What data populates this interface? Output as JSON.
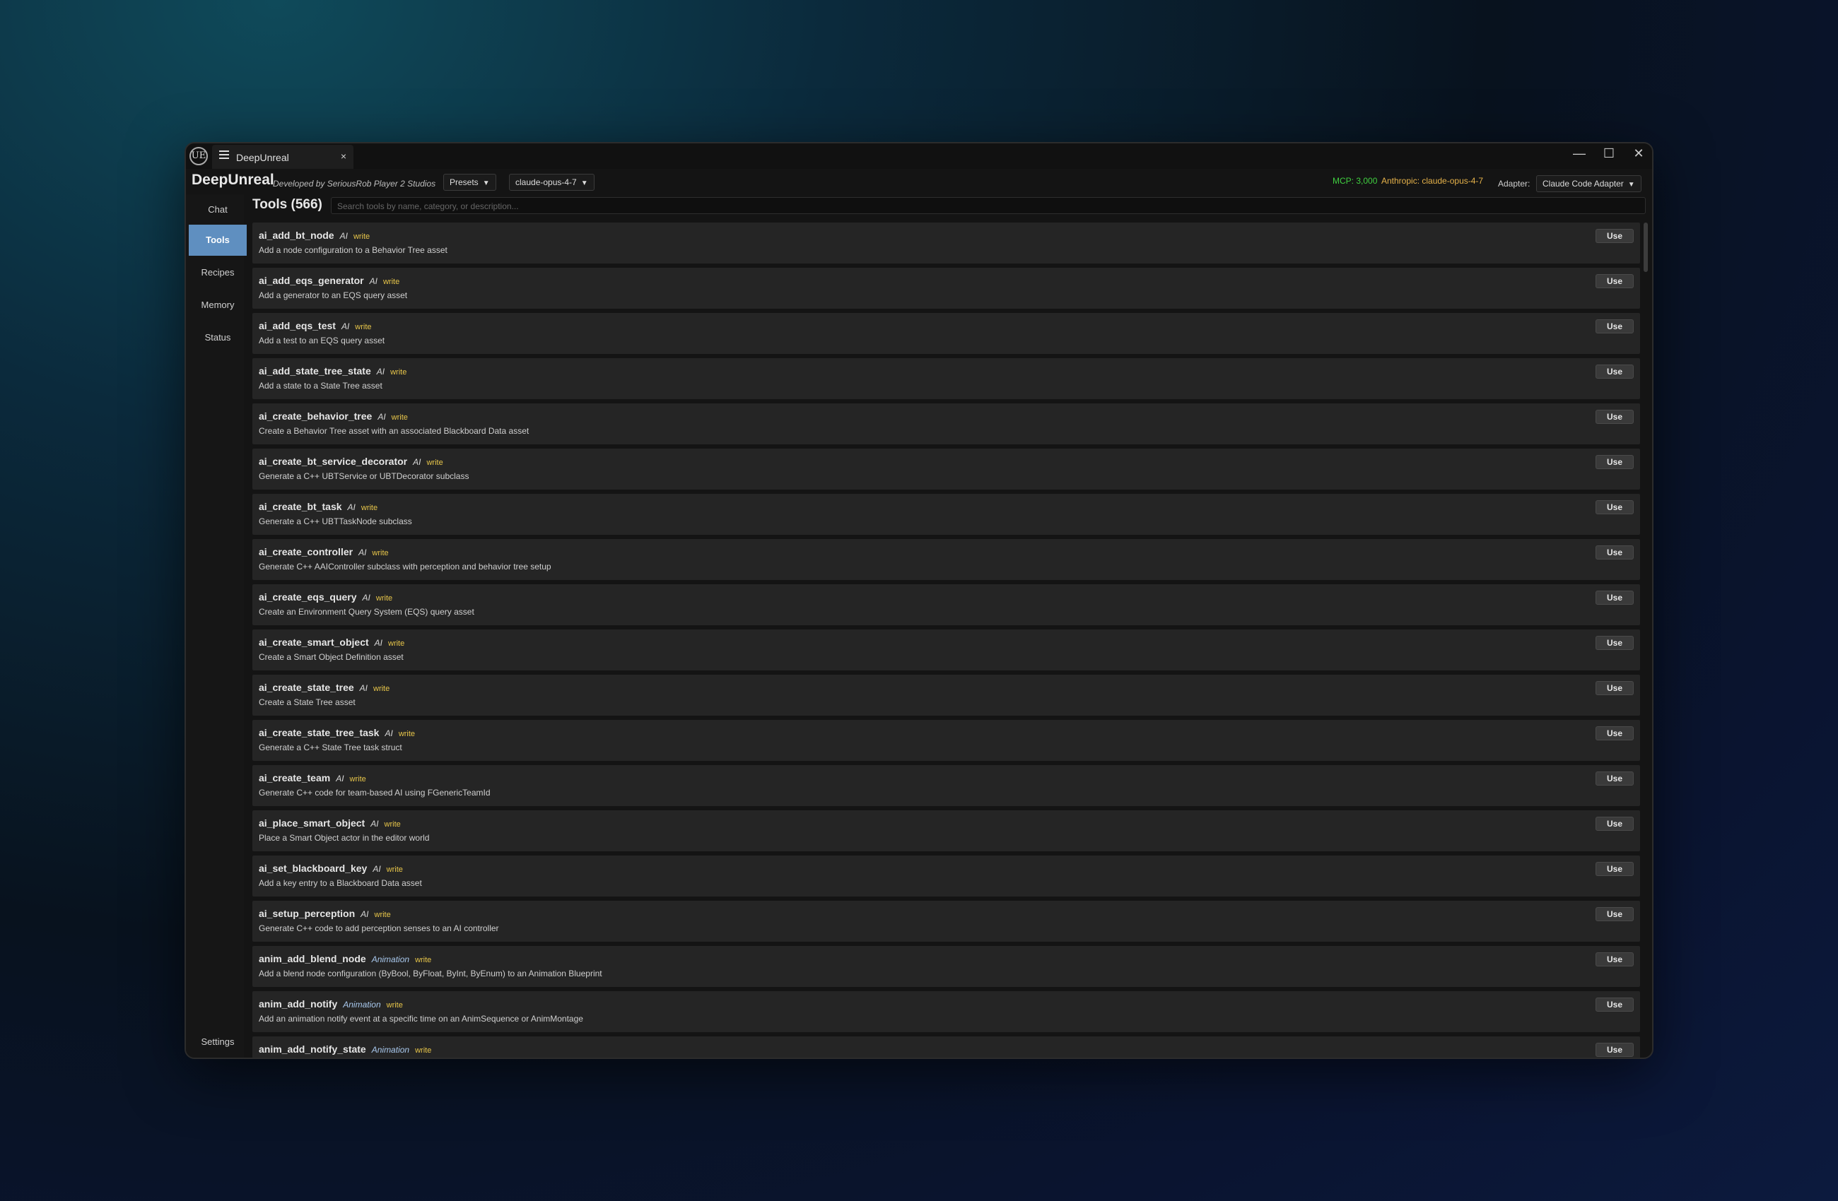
{
  "titlebar": {
    "logo": "UE",
    "tab_title": "DeepUnreal",
    "tab_close": "×",
    "minimize": "—",
    "maximize": "☐",
    "close": "✕"
  },
  "header": {
    "app_name": "DeepUnreal",
    "developer": "Developed by SeriousRob Player 2 Studios",
    "presets_label": "Presets",
    "model_label": "claude-opus-4-7",
    "mcp_status": "MCP: 3,000",
    "anthropic_status": "Anthropic: claude-opus-4-7",
    "adapter_label": "Adapter:",
    "adapter_value": "Claude Code Adapter",
    "status_colors": {
      "mcp": "#40d040",
      "anthropic": "#e6b24a"
    }
  },
  "sidebar": {
    "items": [
      {
        "label": "Chat",
        "active": false
      },
      {
        "label": "Tools",
        "active": true
      },
      {
        "label": "Recipes",
        "active": false
      },
      {
        "label": "Memory",
        "active": false
      },
      {
        "label": "Status",
        "active": false
      }
    ],
    "settings_label": "Settings",
    "accent_color": "#5f8fc0"
  },
  "main": {
    "title": "Tools (566)",
    "search_placeholder": "Search tools by name, category, or description...",
    "use_label": "Use",
    "tools": [
      {
        "name": "ai_add_bt_node",
        "category": "AI",
        "perm": "write",
        "desc": "Add a node configuration to a Behavior Tree asset"
      },
      {
        "name": "ai_add_eqs_generator",
        "category": "AI",
        "perm": "write",
        "desc": "Add a generator to an EQS query asset"
      },
      {
        "name": "ai_add_eqs_test",
        "category": "AI",
        "perm": "write",
        "desc": "Add a test to an EQS query asset"
      },
      {
        "name": "ai_add_state_tree_state",
        "category": "AI",
        "perm": "write",
        "desc": "Add a state to a State Tree asset"
      },
      {
        "name": "ai_create_behavior_tree",
        "category": "AI",
        "perm": "write",
        "desc": "Create a Behavior Tree asset with an associated Blackboard Data asset"
      },
      {
        "name": "ai_create_bt_service_decorator",
        "category": "AI",
        "perm": "write",
        "desc": "Generate a C++ UBTService or UBTDecorator subclass"
      },
      {
        "name": "ai_create_bt_task",
        "category": "AI",
        "perm": "write",
        "desc": "Generate a C++ UBTTaskNode subclass"
      },
      {
        "name": "ai_create_controller",
        "category": "AI",
        "perm": "write",
        "desc": "Generate C++ AAIController subclass with perception and behavior tree setup"
      },
      {
        "name": "ai_create_eqs_query",
        "category": "AI",
        "perm": "write",
        "desc": "Create an Environment Query System (EQS) query asset"
      },
      {
        "name": "ai_create_smart_object",
        "category": "AI",
        "perm": "write",
        "desc": "Create a Smart Object Definition asset"
      },
      {
        "name": "ai_create_state_tree",
        "category": "AI",
        "perm": "write",
        "desc": "Create a State Tree asset"
      },
      {
        "name": "ai_create_state_tree_task",
        "category": "AI",
        "perm": "write",
        "desc": "Generate a C++ State Tree task struct"
      },
      {
        "name": "ai_create_team",
        "category": "AI",
        "perm": "write",
        "desc": "Generate C++ code for team-based AI using FGenericTeamId"
      },
      {
        "name": "ai_place_smart_object",
        "category": "AI",
        "perm": "write",
        "desc": "Place a Smart Object actor in the editor world"
      },
      {
        "name": "ai_set_blackboard_key",
        "category": "AI",
        "perm": "write",
        "desc": "Add a key entry to a Blackboard Data asset"
      },
      {
        "name": "ai_setup_perception",
        "category": "AI",
        "perm": "write",
        "desc": "Generate C++ code to add perception senses to an AI controller"
      },
      {
        "name": "anim_add_blend_node",
        "category": "Animation",
        "perm": "write",
        "desc": "Add a blend node configuration (ByBool, ByFloat, ByInt, ByEnum) to an Animation Blueprint"
      },
      {
        "name": "anim_add_notify",
        "category": "Animation",
        "perm": "write",
        "desc": "Add an animation notify event at a specific time on an AnimSequence or AnimMontage"
      },
      {
        "name": "anim_add_notify_state",
        "category": "Animation",
        "perm": "write",
        "desc": ""
      }
    ]
  }
}
